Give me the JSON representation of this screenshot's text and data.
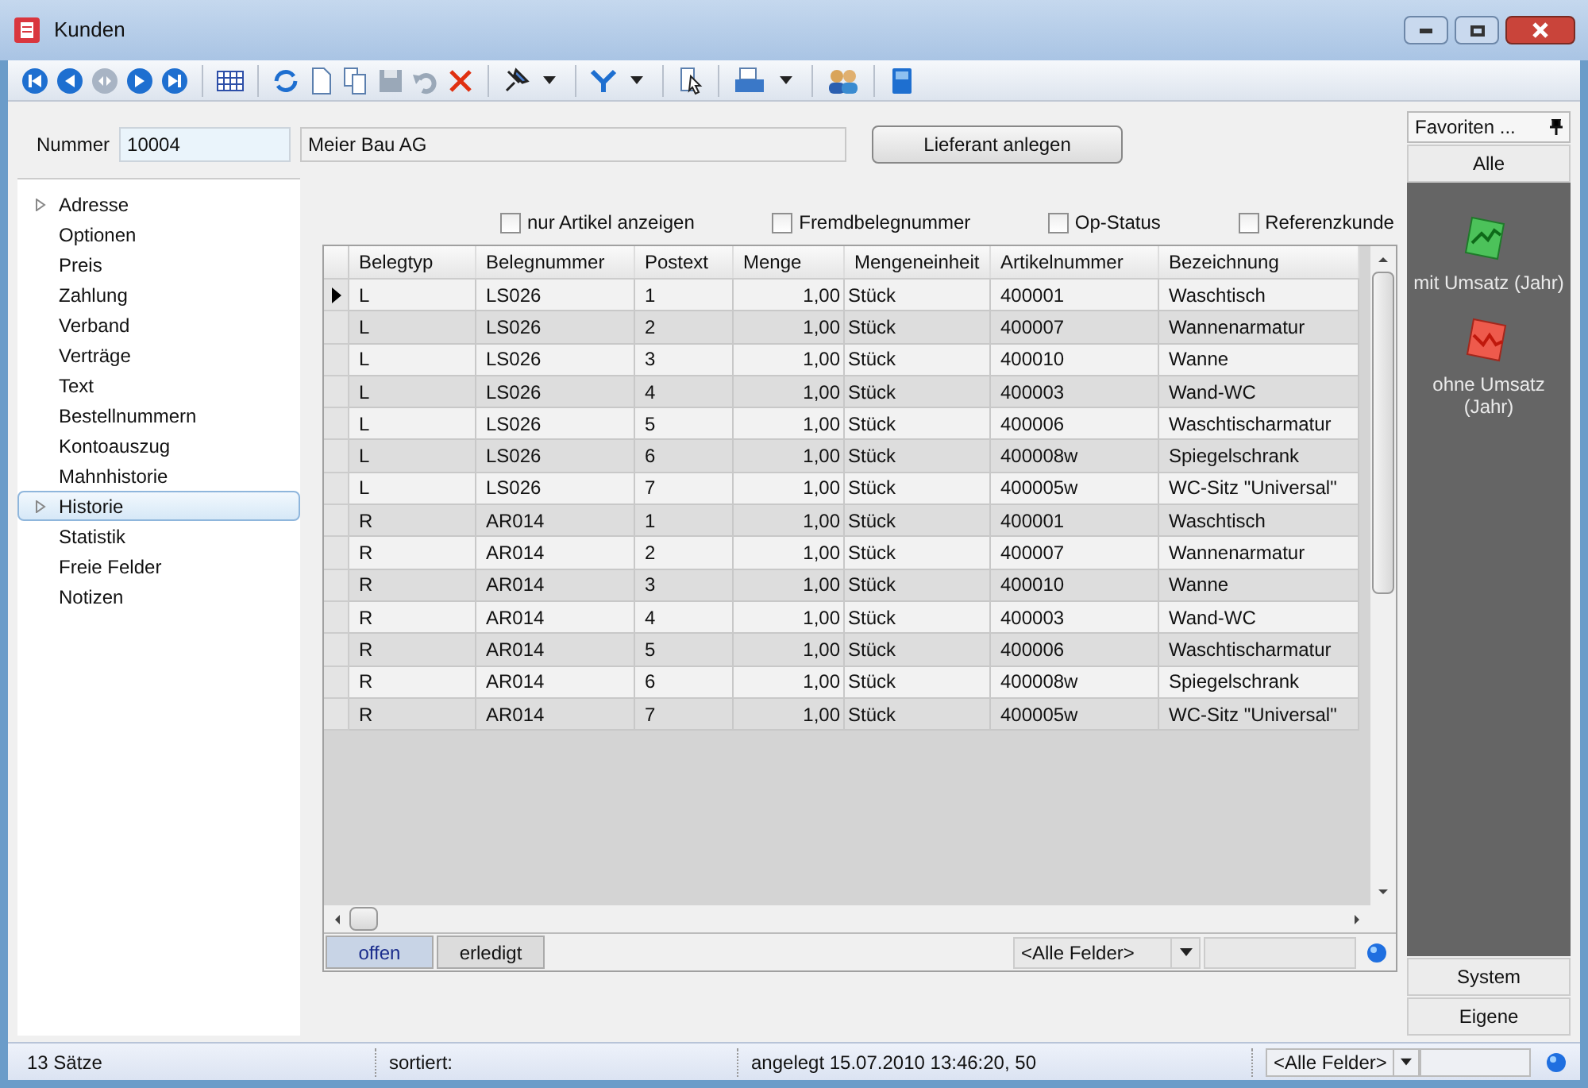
{
  "window": {
    "title": "Kunden"
  },
  "form": {
    "number_label": "Nummer",
    "number": "10004",
    "name": "Meier Bau AG",
    "button": "Lieferant anlegen"
  },
  "sidebar": {
    "items": [
      {
        "label": "Adresse",
        "expandable": true,
        "selected": false
      },
      {
        "label": "Optionen",
        "expandable": false,
        "selected": false
      },
      {
        "label": "Preis",
        "expandable": false,
        "selected": false
      },
      {
        "label": "Zahlung",
        "expandable": false,
        "selected": false
      },
      {
        "label": "Verband",
        "expandable": false,
        "selected": false
      },
      {
        "label": "Verträge",
        "expandable": false,
        "selected": false
      },
      {
        "label": "Text",
        "expandable": false,
        "selected": false
      },
      {
        "label": "Bestellnummern",
        "expandable": false,
        "selected": false
      },
      {
        "label": "Kontoauszug",
        "expandable": false,
        "selected": false
      },
      {
        "label": "Mahnhistorie",
        "expandable": false,
        "selected": false
      },
      {
        "label": "Historie",
        "expandable": true,
        "selected": true
      },
      {
        "label": "Statistik",
        "expandable": false,
        "selected": false
      },
      {
        "label": "Freie Felder",
        "expandable": false,
        "selected": false
      },
      {
        "label": "Notizen",
        "expandable": false,
        "selected": false
      }
    ]
  },
  "options": [
    {
      "label": "nur Artikel anzeigen",
      "checked": false
    },
    {
      "label": "Fremdbelegnummer",
      "checked": false
    },
    {
      "label": "Op-Status",
      "checked": false
    },
    {
      "label": "Referenzkunde",
      "checked": false
    }
  ],
  "table": {
    "columns": [
      "Belegtyp",
      "Belegnummer",
      "Postext",
      "Menge",
      "Mengeneinheit",
      "Artikelnummer",
      "Bezeichnung"
    ],
    "rows": [
      {
        "cells": [
          "L",
          "LS026",
          "1",
          "1,00",
          "Stück",
          "400001",
          "Waschtisch"
        ],
        "selected": true
      },
      {
        "cells": [
          "L",
          "LS026",
          "2",
          "1,00",
          "Stück",
          "400007",
          "Wannenarmatur"
        ],
        "selected": false
      },
      {
        "cells": [
          "L",
          "LS026",
          "3",
          "1,00",
          "Stück",
          "400010",
          "Wanne"
        ],
        "selected": false
      },
      {
        "cells": [
          "L",
          "LS026",
          "4",
          "1,00",
          "Stück",
          "400003",
          "Wand-WC"
        ],
        "selected": false
      },
      {
        "cells": [
          "L",
          "LS026",
          "5",
          "1,00",
          "Stück",
          "400006",
          "Waschtischarmatur"
        ],
        "selected": false
      },
      {
        "cells": [
          "L",
          "LS026",
          "6",
          "1,00",
          "Stück",
          "400008w",
          "Spiegelschrank"
        ],
        "selected": false
      },
      {
        "cells": [
          "L",
          "LS026",
          "7",
          "1,00",
          "Stück",
          "400005w",
          "WC-Sitz \"Universal\""
        ],
        "selected": false
      },
      {
        "cells": [
          "R",
          "AR014",
          "1",
          "1,00",
          "Stück",
          "400001",
          "Waschtisch"
        ],
        "selected": false
      },
      {
        "cells": [
          "R",
          "AR014",
          "2",
          "1,00",
          "Stück",
          "400007",
          "Wannenarmatur"
        ],
        "selected": false
      },
      {
        "cells": [
          "R",
          "AR014",
          "3",
          "1,00",
          "Stück",
          "400010",
          "Wanne"
        ],
        "selected": false
      },
      {
        "cells": [
          "R",
          "AR014",
          "4",
          "1,00",
          "Stück",
          "400003",
          "Wand-WC"
        ],
        "selected": false
      },
      {
        "cells": [
          "R",
          "AR014",
          "5",
          "1,00",
          "Stück",
          "400006",
          "Waschtischarmatur"
        ],
        "selected": false
      },
      {
        "cells": [
          "R",
          "AR014",
          "6",
          "1,00",
          "Stück",
          "400008w",
          "Spiegelschrank"
        ],
        "selected": false
      },
      {
        "cells": [
          "R",
          "AR014",
          "7",
          "1,00",
          "Stück",
          "400005w",
          "WC-Sitz \"Universal\""
        ],
        "selected": false
      }
    ]
  },
  "grid_tabs": [
    {
      "label": "offen",
      "selected": true
    },
    {
      "label": "erledigt",
      "selected": false
    }
  ],
  "grid_filter": "<Alle Felder>",
  "favorites": {
    "title": "Favoriten ...",
    "tab": "Alle",
    "items": [
      {
        "label": "mit Umsatz (Jahr)",
        "kind": "up"
      },
      {
        "label": "ohne Umsatz (Jahr)",
        "kind": "down"
      }
    ],
    "buttons": [
      "System",
      "Eigene"
    ]
  },
  "status_bar": {
    "count": "13 Sätze",
    "sort": "sortiert:",
    "created": "angelegt 15.07.2010 13:46:20, 50",
    "filter": "<Alle Felder>"
  }
}
